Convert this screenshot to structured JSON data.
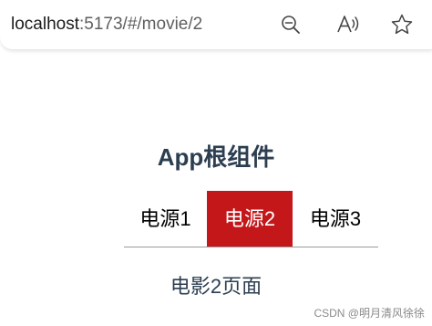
{
  "browser": {
    "url_host": "localhost",
    "url_rest": ":5173/#/movie/2",
    "icons": {
      "zoom": "zoom-out-icon",
      "read_aloud": "read-aloud-icon",
      "favorite": "star-icon"
    }
  },
  "app": {
    "title": "App根组件",
    "nav": [
      {
        "label": "电源1",
        "active": false
      },
      {
        "label": "电源2",
        "active": true
      },
      {
        "label": "电源3",
        "active": false
      }
    ],
    "content_text": "电影2页面"
  },
  "colors": {
    "active_tab_bg": "#c4171a",
    "title_text": "#2c3e50"
  },
  "watermark": "CSDN @明月清风徐徐"
}
